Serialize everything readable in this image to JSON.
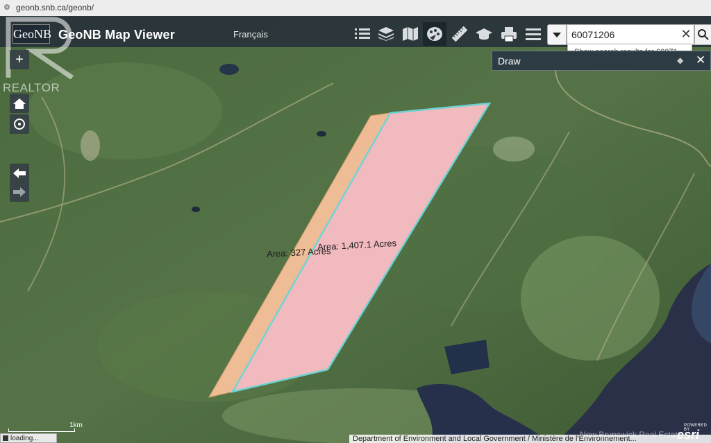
{
  "browser": {
    "url": "geonb.snb.ca/geonb/",
    "site_icon": "site-settings-icon"
  },
  "header": {
    "logo_text": "GeoNB",
    "title": "GeoNB Map Viewer",
    "language_link": "Français"
  },
  "toolbar": {
    "tools": [
      {
        "name": "legend",
        "icon": "list-icon"
      },
      {
        "name": "layers",
        "icon": "layers-icon"
      },
      {
        "name": "basemap",
        "icon": "map-icon"
      },
      {
        "name": "draw",
        "icon": "draw-icon",
        "active": true
      },
      {
        "name": "measure",
        "icon": "ruler-icon"
      },
      {
        "name": "education",
        "icon": "graduation-cap-icon"
      },
      {
        "name": "print",
        "icon": "print-icon"
      },
      {
        "name": "menu",
        "icon": "menu-icon"
      }
    ]
  },
  "search": {
    "value": "60071206",
    "suggestion": "Show search results for 60071..."
  },
  "draw_panel": {
    "title": "Draw"
  },
  "watermark": {
    "text": "REALTOR"
  },
  "map": {
    "parcels": [
      {
        "label": "Area: 327 Acres",
        "color": "#f7c09a"
      },
      {
        "label": "Area: 1,407.1 Acres",
        "color": "#f7bdc2",
        "outline": "#6fd6d9"
      }
    ],
    "scale_label": "1km",
    "status": "loading...",
    "powered_by": "POWERED BY",
    "esri": "esri",
    "attribution": "Department of Environment and Local Government / Ministère de l'Environnement...",
    "attribution_watermark": "New Brunswick Real Estate"
  }
}
